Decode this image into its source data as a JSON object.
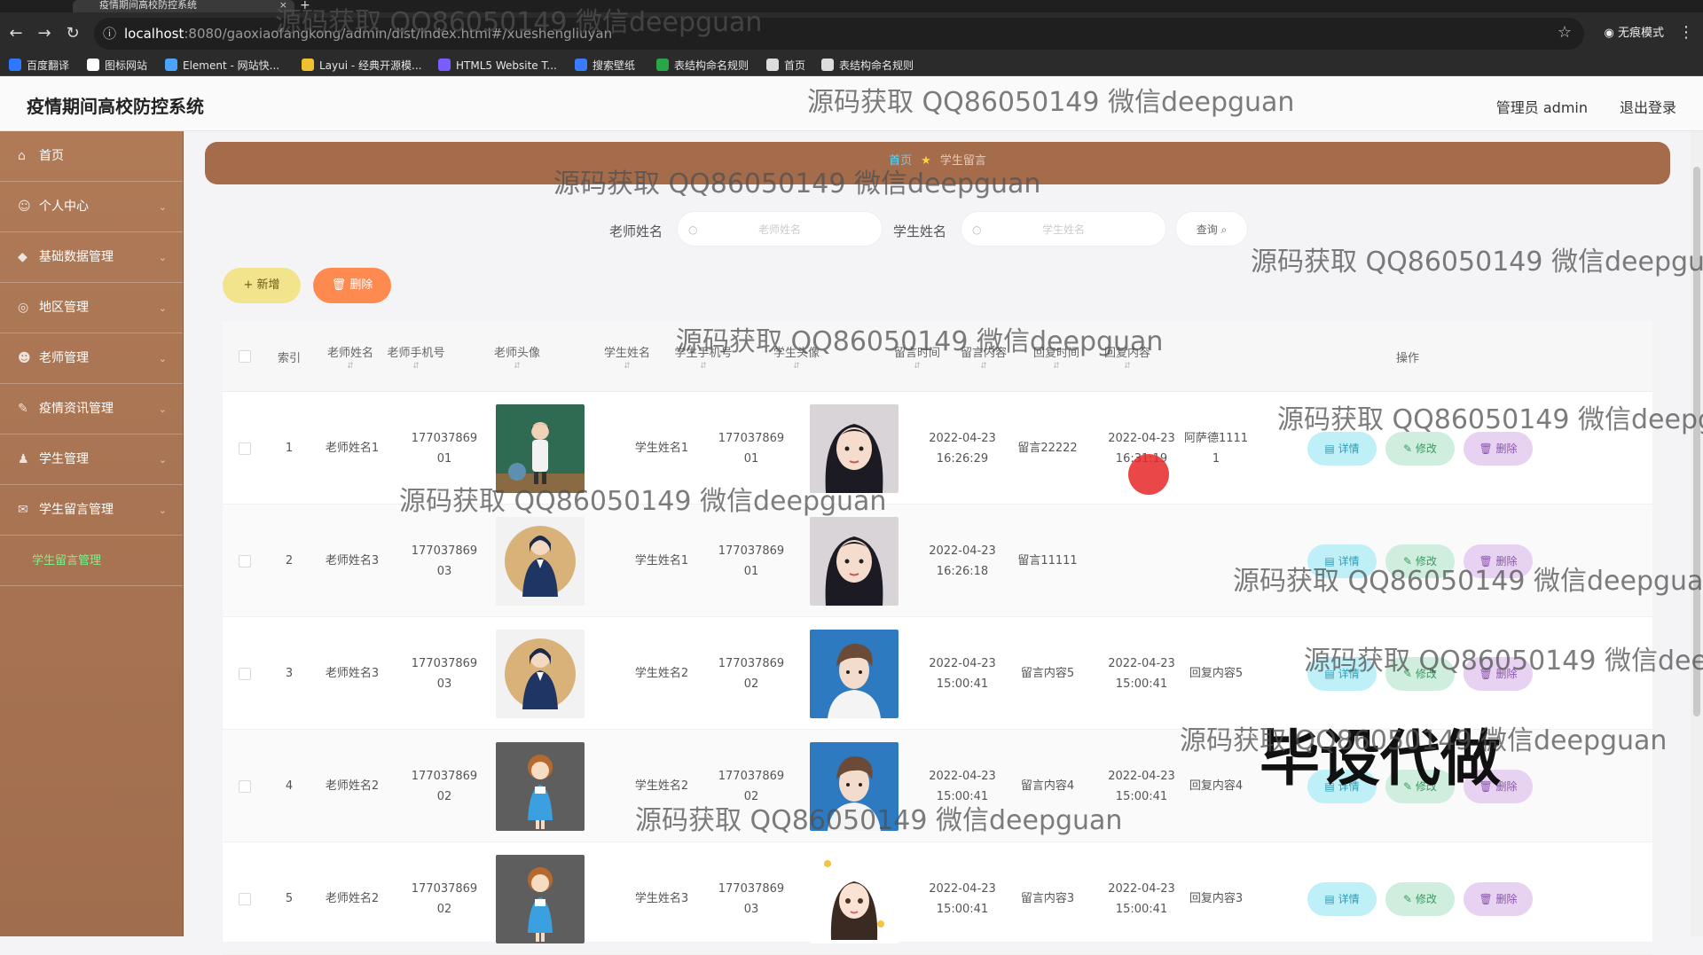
{
  "browser": {
    "tab_title": "疫情期间高校防控系统",
    "tab_close": "×",
    "new_tab": "+",
    "url_host": "localhost",
    "url_rest": ":8080/gaoxiaofangkong/admin/dist/index.html#/xueshengliuyan",
    "incognito_label": "无痕模式",
    "bookmarks": [
      "百度翻译",
      "图标网站",
      "Element - 网站快...",
      "Layui - 经典开源模...",
      "HTML5 Website T...",
      "搜索壁纸",
      "表结构命名规则",
      "首页",
      "表结构命名规则"
    ],
    "bookmark_colors": [
      "#2e78ff",
      "#ffffff",
      "#4aa3ff",
      "#f0c030",
      "#7a5cff",
      "#3a7bff",
      "#27a745",
      "#dddddd",
      "#dddddd"
    ]
  },
  "header": {
    "title": "疫情期间高校防控系统",
    "admin": "管理员 admin",
    "logout": "退出登录"
  },
  "sidebar": {
    "items": [
      {
        "label": "首页",
        "icon": "home-icon",
        "glyph": "⌂",
        "chevron": false
      },
      {
        "label": "个人中心",
        "icon": "user-icon",
        "glyph": "☺",
        "chevron": true
      },
      {
        "label": "基础数据管理",
        "icon": "data-icon",
        "glyph": "◆",
        "chevron": true
      },
      {
        "label": "地区管理",
        "icon": "map-icon",
        "glyph": "◎",
        "chevron": true
      },
      {
        "label": "老师管理",
        "icon": "teacher-icon",
        "glyph": "☻",
        "chevron": true
      },
      {
        "label": "疫情资讯管理",
        "icon": "news-icon",
        "glyph": "✎",
        "chevron": true
      },
      {
        "label": "学生管理",
        "icon": "student-icon",
        "glyph": "♟",
        "chevron": true
      },
      {
        "label": "学生留言管理",
        "icon": "message-icon",
        "glyph": "✉",
        "chevron": true
      }
    ],
    "sub_item": "学生留言管理"
  },
  "breadcrumb": {
    "home": "首页",
    "star": "★",
    "current": "学生留言"
  },
  "search": {
    "teacher_label": "老师姓名",
    "teacher_placeholder": "老师姓名",
    "student_label": "学生姓名",
    "student_placeholder": "学生姓名",
    "query": "查询"
  },
  "toolbar": {
    "add": "+ 新增",
    "delete": "删除"
  },
  "table": {
    "headers": [
      "索引",
      "老师姓名",
      "老师手机号",
      "老师头像",
      "学生姓名",
      "学生手机号",
      "学生头像",
      "留言时间",
      "留言内容",
      "回复时间",
      "回复内容",
      "操作"
    ],
    "rows": [
      {
        "index": "1",
        "teacher": "老师姓名1",
        "tphone": "17703786901",
        "tavatar": "classroom",
        "student": "学生姓名1",
        "sphone": "17703786901",
        "savatar": "girl",
        "mtime": "2022-04-23 16:26:29",
        "content": "留言22222",
        "rtime": "2022-04-23 16:31:19",
        "reply": "阿萨德11111"
      },
      {
        "index": "2",
        "teacher": "老师姓名3",
        "tphone": "17703786903",
        "tavatar": "woman",
        "student": "学生姓名1",
        "sphone": "17703786901",
        "savatar": "girl",
        "mtime": "2022-04-23 16:26:18",
        "content": "留言11111",
        "rtime": "",
        "reply": ""
      },
      {
        "index": "3",
        "teacher": "老师姓名3",
        "tphone": "17703786903",
        "tavatar": "woman",
        "student": "学生姓名2",
        "sphone": "17703786902",
        "savatar": "boy",
        "mtime": "2022-04-23 15:00:41",
        "content": "留言内容5",
        "rtime": "2022-04-23 15:00:41",
        "reply": "回复内容5"
      },
      {
        "index": "4",
        "teacher": "老师姓名2",
        "tphone": "17703786902",
        "tavatar": "cartoon",
        "student": "学生姓名2",
        "sphone": "17703786902",
        "savatar": "boy",
        "mtime": "2022-04-23 15:00:41",
        "content": "留言内容4",
        "rtime": "2022-04-23 15:00:41",
        "reply": "回复内容4"
      },
      {
        "index": "5",
        "teacher": "老师姓名2",
        "tphone": "17703786902",
        "tavatar": "cartoon",
        "student": "学生姓名3",
        "sphone": "17703786903",
        "savatar": "anime",
        "mtime": "2022-04-23 15:00:41",
        "content": "留言内容3",
        "rtime": "2022-04-23 15:00:41",
        "reply": "回复内容3"
      }
    ],
    "actions": {
      "detail": "详情",
      "edit": "修改",
      "delete": "删除"
    }
  },
  "watermark_text": "源码获取 QQ86050149 微信deepguan",
  "big_watermark": "毕设代做"
}
